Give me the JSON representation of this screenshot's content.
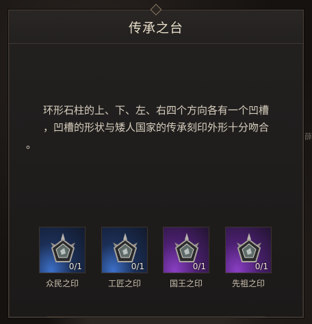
{
  "dialog": {
    "title": "传承之台",
    "description_lines": [
      "环形石柱的上、下、左、右四个方向各有一个凹槽",
      "，凹槽的形状与矮人国家的传承刻印外形十分吻合",
      "。"
    ]
  },
  "background": {
    "edge_text": "薛"
  },
  "slots": [
    {
      "label": "众民之印",
      "count": "0/1",
      "rarity_color": "#3d70c8",
      "icon": "seal-emblem-icon"
    },
    {
      "label": "工匠之印",
      "count": "0/1",
      "rarity_color": "#3d70c8",
      "icon": "seal-emblem-icon"
    },
    {
      "label": "国王之印",
      "count": "0/1",
      "rarity_color": "#8a3fc4",
      "icon": "seal-emblem-icon"
    },
    {
      "label": "先祖之印",
      "count": "0/1",
      "rarity_color": "#8a3fc4",
      "icon": "seal-emblem-icon"
    }
  ]
}
